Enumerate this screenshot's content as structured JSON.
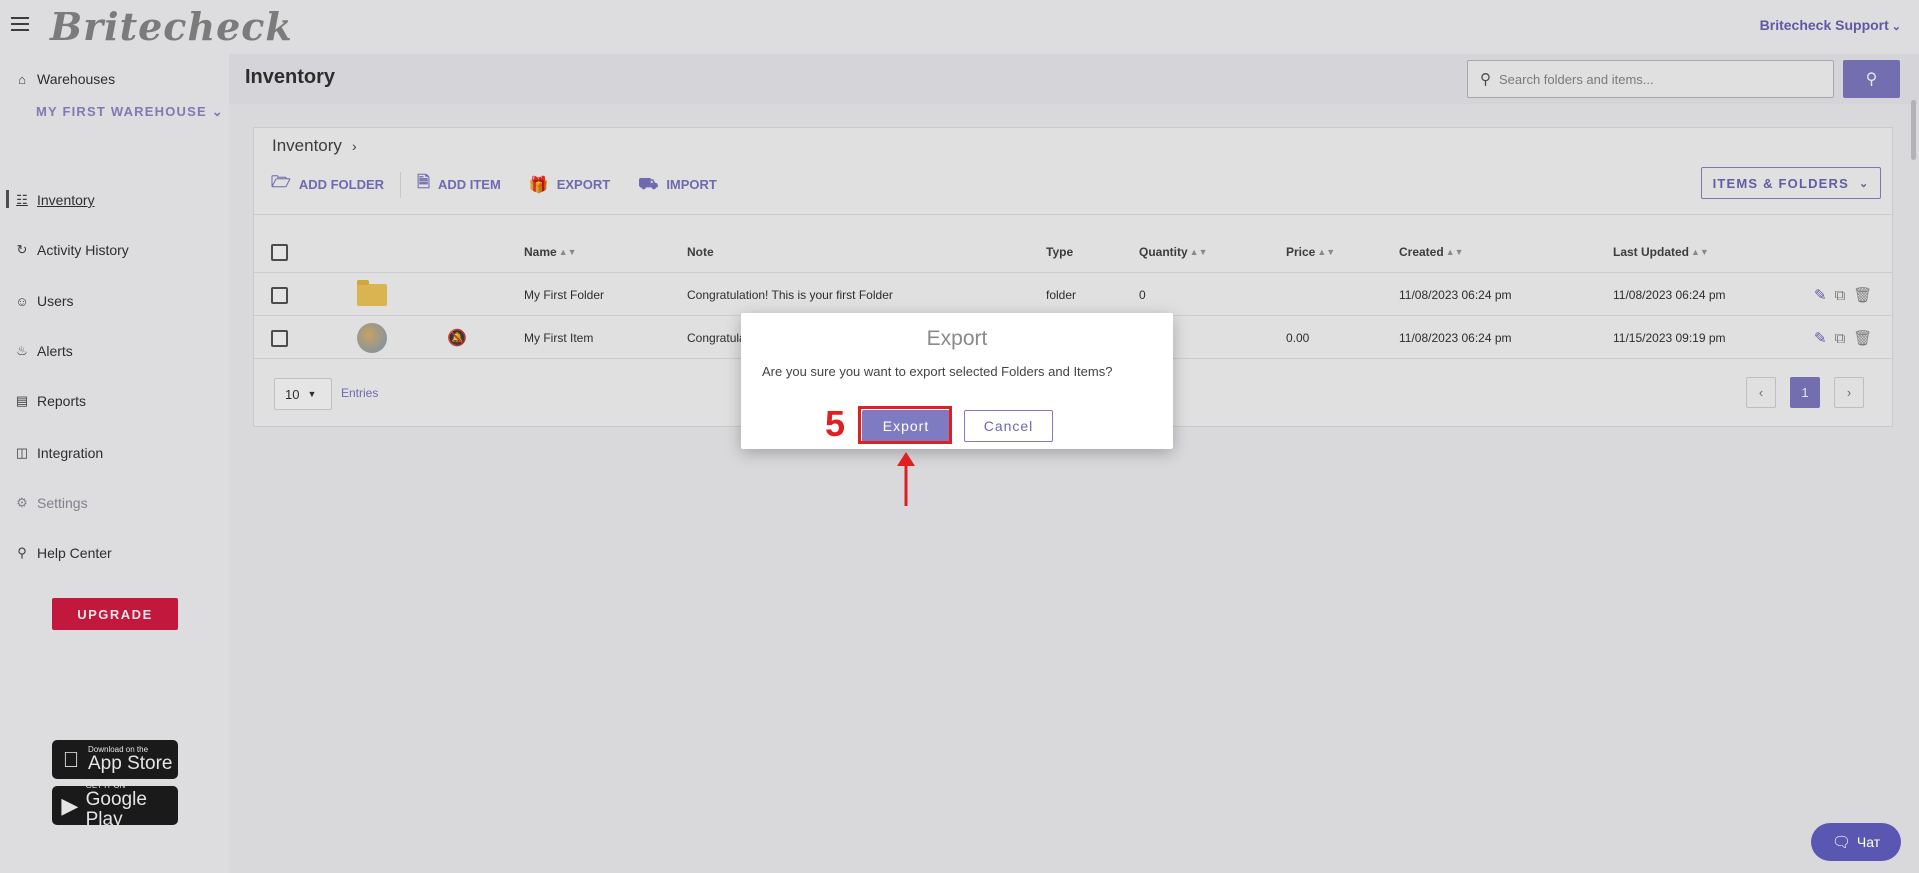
{
  "app": {
    "logo": "Britecheck",
    "user_menu": "Britecheck Support"
  },
  "sidebar": {
    "warehouses_label": "Warehouses",
    "warehouse_selected": "MY FIRST WAREHOUSE",
    "items": [
      {
        "label": "Inventory",
        "icon": "inventory-icon"
      },
      {
        "label": "Activity History",
        "icon": "history-icon"
      },
      {
        "label": "Users",
        "icon": "users-icon"
      },
      {
        "label": "Alerts",
        "icon": "bell-icon"
      },
      {
        "label": "Reports",
        "icon": "reports-icon"
      },
      {
        "label": "Integration",
        "icon": "integration-icon"
      },
      {
        "label": "Settings",
        "icon": "gear-icon"
      },
      {
        "label": "Help Center",
        "icon": "help-icon"
      }
    ],
    "upgrade_label": "UPGRADE",
    "app_store": {
      "small": "Download on the",
      "big": "App Store"
    },
    "google_play": {
      "small": "GET IT ON",
      "big": "Google Play"
    }
  },
  "header": {
    "title": "Inventory",
    "search_placeholder": "Search folders and items..."
  },
  "content": {
    "breadcrumb": "Inventory",
    "actions": {
      "add_folder": "ADD FOLDER",
      "add_item": "ADD ITEM",
      "export": "EXPORT",
      "import": "IMPORT"
    },
    "view_select": "ITEMS & FOLDERS",
    "columns": {
      "name": "Name",
      "note": "Note",
      "type": "Type",
      "quantity": "Quantity",
      "price": "Price",
      "created": "Created",
      "updated": "Last Updated"
    },
    "rows": [
      {
        "name": "My First Folder",
        "note": "Congratulation! This is your first Folder",
        "type": "folder",
        "quantity": "0",
        "price": "",
        "created": "11/08/2023 06:24 pm",
        "updated": "11/08/2023 06:24 pm"
      },
      {
        "name": "My First Item",
        "note": "Congratula",
        "type": "",
        "quantity": "",
        "price": "0.00",
        "created": "11/08/2023 06:24 pm",
        "updated": "11/15/2023 09:19 pm"
      }
    ],
    "page_size": "10",
    "entries_label": "Entries",
    "current_page": "1"
  },
  "dialog": {
    "title": "Export",
    "message": "Are you sure you want to export selected Folders and Items?",
    "confirm_label": "Export",
    "cancel_label": "Cancel"
  },
  "annotation": {
    "step_number": "5",
    "color": "#e02020"
  },
  "chat": {
    "label": "Чат"
  },
  "colors": {
    "accent": "#7f7bc3",
    "upgrade": "#d81b46"
  }
}
